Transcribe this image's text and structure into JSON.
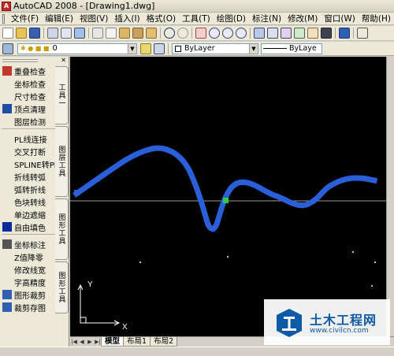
{
  "window": {
    "title": "AutoCAD 2008 - [Drawing1.dwg]"
  },
  "menu": [
    "文件(F)",
    "编辑(E)",
    "视图(V)",
    "插入(I)",
    "格式(O)",
    "工具(T)",
    "绘图(D)",
    "标注(N)",
    "修改(M)",
    "窗口(W)",
    "帮助(H)"
  ],
  "layer_bar": {
    "current_layer": "0",
    "color": "ByLayer",
    "linetype": "ByLaye"
  },
  "tool_panel": {
    "items": [
      {
        "label": "重叠检查",
        "icon": "overlap-check-icon",
        "color": "#c0392b"
      },
      {
        "label": "坐标检查",
        "icon": "none"
      },
      {
        "label": "尺寸检查",
        "icon": "none"
      },
      {
        "label": "顶点清理",
        "icon": "vertex-clean-icon",
        "color": "#1f4fa3"
      },
      {
        "label": "图层检测",
        "icon": "none"
      },
      {
        "divider": true
      },
      {
        "label": "PL线连接",
        "icon": "none"
      },
      {
        "label": "交叉打断",
        "icon": "none"
      },
      {
        "label": "SPLINE转PL",
        "icon": "none"
      },
      {
        "label": "折线转弧",
        "icon": "none"
      },
      {
        "label": "弧转折线",
        "icon": "none"
      },
      {
        "label": "色块转线",
        "icon": "none"
      },
      {
        "label": "单边遮缩",
        "icon": "none"
      },
      {
        "label": "自由填色",
        "icon": "fill-color-icon",
        "color": "#0a2a9a"
      },
      {
        "divider": true
      },
      {
        "label": "坐标标注",
        "icon": "coord-mark-icon",
        "color": "#555555"
      },
      {
        "label": "Z值降零",
        "icon": "none"
      },
      {
        "label": "修改线宽",
        "icon": "none"
      },
      {
        "label": "字高精度",
        "icon": "none"
      },
      {
        "label": "图形裁剪",
        "icon": "shape-clip-icon",
        "color": "#2f5fb3"
      },
      {
        "label": "裁剪存图",
        "icon": "clip-save-icon",
        "color": "#2f5fb3"
      }
    ],
    "tabs": [
      "工具一",
      "图层工具",
      "图形工具",
      "图形工具"
    ]
  },
  "canvas": {
    "background": "#000000",
    "curve_color": "#2b5fd9",
    "axis_line_color": "#9a9a9a",
    "grip_color": "#2ecc40",
    "ucs": {
      "y": "Y",
      "x": "X"
    }
  },
  "layout_tabs": [
    "模型",
    "布局1",
    "布局2"
  ],
  "watermark": {
    "text": "土木工程网",
    "url": "www.civilcn.com"
  }
}
